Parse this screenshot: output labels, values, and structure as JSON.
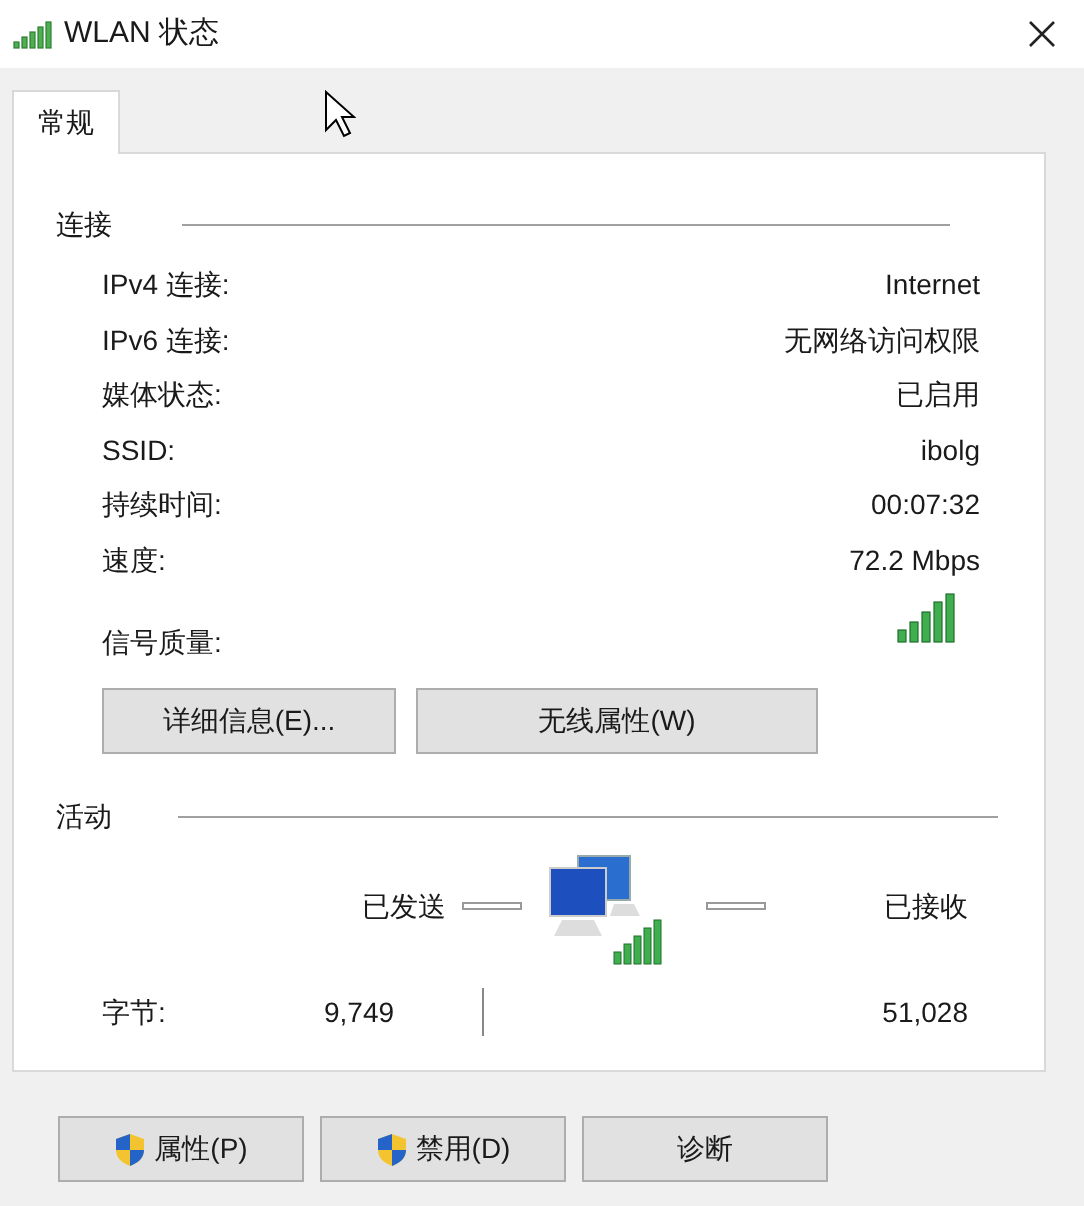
{
  "window": {
    "title": "WLAN 状态"
  },
  "tabs": [
    {
      "label": "常规",
      "selected": true
    }
  ],
  "connection": {
    "heading": "连接",
    "rows": [
      {
        "label": "IPv4 连接:",
        "value": "Internet"
      },
      {
        "label": "IPv6 连接:",
        "value": "无网络访问权限"
      },
      {
        "label": "媒体状态:",
        "value": "已启用"
      },
      {
        "label": "SSID:",
        "value": "ibolg"
      },
      {
        "label": "持续时间:",
        "value": "00:07:32"
      },
      {
        "label": "速度:",
        "value": "72.2 Mbps"
      }
    ],
    "signal_label": "信号质量:",
    "buttons": [
      "详细信息(E)...",
      "无线属性(W)"
    ]
  },
  "activity": {
    "heading": "活动",
    "sent_label": "已发送",
    "received_label": "已接收",
    "bytes_label": "字节:",
    "bytes_sent": "9,749",
    "bytes_received": "51,028"
  },
  "buttons": [
    {
      "label": "属性(P)",
      "shield": true
    },
    {
      "label": "禁用(D)",
      "shield": true
    },
    {
      "label": "诊断",
      "shield": false
    }
  ]
}
